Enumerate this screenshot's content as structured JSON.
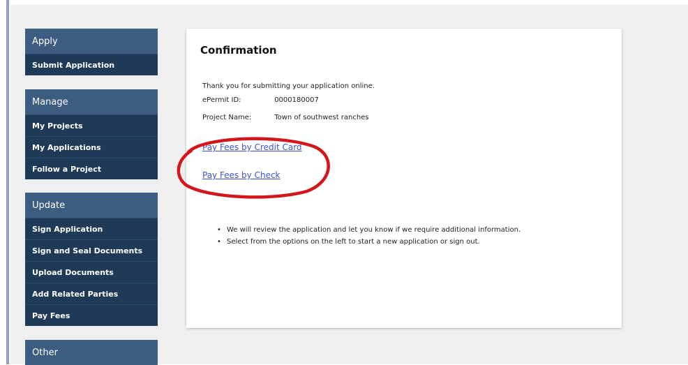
{
  "sidebar": {
    "groups": [
      {
        "header": "Apply",
        "items": [
          "Submit Application"
        ]
      },
      {
        "header": "Manage",
        "items": [
          "My Projects",
          "My Applications",
          "Follow a Project"
        ]
      },
      {
        "header": "Update",
        "items": [
          "Sign Application",
          "Sign and Seal Documents",
          "Upload Documents",
          "Add Related Parties",
          "Pay Fees"
        ]
      },
      {
        "header": "Other",
        "items": []
      }
    ]
  },
  "panel": {
    "title": "Confirmation",
    "thank_you": "Thank you for submitting your application online.",
    "fields": [
      {
        "label": "ePermit ID:",
        "value": "0000180007"
      },
      {
        "label": "Project Name:",
        "value": "Town of southwest ranches"
      }
    ],
    "links": {
      "credit_card": "Pay Fees by Credit Card",
      "check": "Pay Fees by Check"
    },
    "notes": [
      "We will review the application and let you know if we require additional information.",
      "Select from the options on the left to start a new application or sign out."
    ]
  },
  "colors": {
    "sidebar_header": "#3c5c80",
    "sidebar_item": "#1f3a57",
    "link": "#3b55c9",
    "annotation_red": "#d4151b"
  }
}
